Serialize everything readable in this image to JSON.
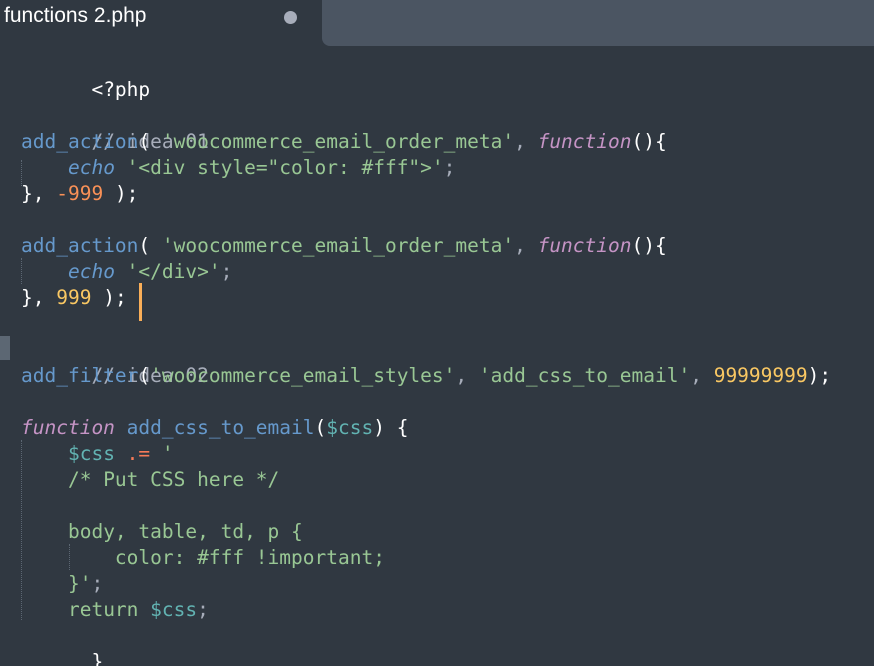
{
  "tab": {
    "title": "functions 2.php",
    "modified_indicator": "circle-icon"
  },
  "code": {
    "l1": "<?php",
    "l3": "// idea 01",
    "l4_fn": "add_action",
    "l4_p1": "( ",
    "l4_s": "'woocommerce_email_order_meta'",
    "l4_p2": ", ",
    "l4_kw": "function",
    "l4_p3": "(){",
    "l5_kw": "echo",
    "l5_s": " '<div style=\"color: #fff\">'",
    "l5_p": ";",
    "l6_p1": "}, ",
    "l6_n": "-999",
    "l6_p2": " );",
    "l8_fn": "add_action",
    "l8_p1": "( ",
    "l8_s": "'woocommerce_email_order_meta'",
    "l8_p2": ", ",
    "l8_kw": "function",
    "l8_p3": "(){",
    "l9_kw": "echo",
    "l9_s": " '</div>'",
    "l9_p": ";",
    "l10_p1": "}, ",
    "l10_n": "999",
    "l10_p2": " );",
    "l12": "// idea 02",
    "l13_fn": "add_filter",
    "l13_p1": "(",
    "l13_s1": "'woocommerce_email_styles'",
    "l13_p2": ", ",
    "l13_s2": "'add_css_to_email'",
    "l13_p3": ", ",
    "l13_n": "99999999",
    "l13_p4": ");",
    "l15_kw": "function",
    "l15_fn": " add_css_to_email",
    "l15_p1": "(",
    "l15_var": "$css",
    "l15_p2": ") {",
    "l16_var": "$css",
    "l16_op": " .= ",
    "l16_s": "'",
    "l17": "/* Put CSS here */",
    "l19": "body, table, td, p {",
    "l20": "color: #fff !important;",
    "l21_s": "}'",
    "l21_p": ";",
    "l22_kw": "return",
    "l22_var": " $css",
    "l22_p": ";",
    "l23": "}"
  },
  "colors": {
    "background": "#303841",
    "comment": "#a7adba",
    "function": "#6699cc",
    "string": "#99c794",
    "keyword": "#c594c5",
    "number": "#f99157",
    "caret": "#f9ae58"
  }
}
